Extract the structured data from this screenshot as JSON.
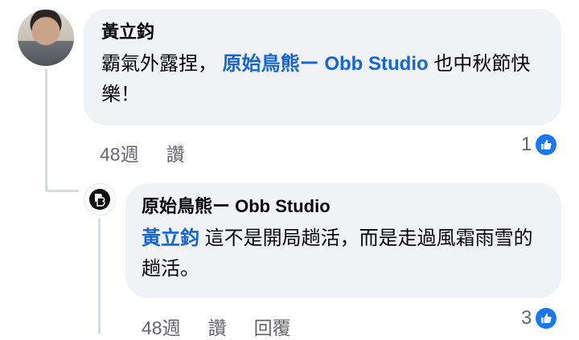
{
  "comment": {
    "author": "黃立鈞",
    "text": "霸氣外露捏，",
    "mention": "原始鳥熊ー Obb Studio",
    "text_after": "也中秋節快樂！",
    "time": "48週",
    "like_label": "讚",
    "reaction_count": "1"
  },
  "reply": {
    "author": "原始鳥熊ー Obb Studio",
    "mention": "黃立鈞",
    "text": "這不是開局趟活，而是走過風霜雨雪的趟活。",
    "time": "48週",
    "like_label": "讚",
    "reply_label": "回覆",
    "reaction_count": "3"
  },
  "colors": {
    "accent": "#1877f2",
    "mention": "#1465d6",
    "bubble": "#f0f2f5",
    "muted": "#65676b"
  }
}
